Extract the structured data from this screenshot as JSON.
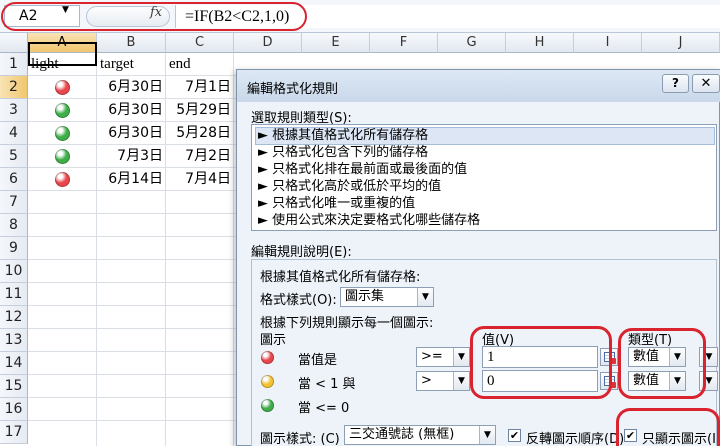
{
  "formula_bar": {
    "name_box": "A2",
    "fx": "fx",
    "formula": "=IF(B2<C2,1,0)"
  },
  "columns": [
    "A",
    "B",
    "C",
    "D",
    "E",
    "F",
    "G",
    "H",
    "I",
    "J"
  ],
  "rows": [
    "1",
    "2",
    "3",
    "4",
    "5",
    "6",
    "7",
    "8",
    "9",
    "10",
    "11",
    "12",
    "13",
    "14",
    "15",
    "16",
    "17"
  ],
  "header_row": {
    "light": "light",
    "target": "target",
    "end": "end"
  },
  "data_rows": [
    {
      "light_color": "#e8464c",
      "target": "6月30日",
      "end": "7月1日"
    },
    {
      "light_color": "#3fae49",
      "target": "6月30日",
      "end": "5月29日"
    },
    {
      "light_color": "#3fae49",
      "target": "6月30日",
      "end": "5月28日"
    },
    {
      "light_color": "#3fae49",
      "target": "7月3日",
      "end": "7月2日"
    },
    {
      "light_color": "#e8464c",
      "target": "6月14日",
      "end": "7月4日"
    }
  ],
  "dialog": {
    "title": "編輯格式化規則",
    "help_label": "?",
    "close_label": "✕",
    "select_rule_type_label": "選取規則類型(S):",
    "rule_types": [
      "► 根據其值格式化所有儲存格",
      "► 只格式化包含下列的儲存格",
      "► 只格式化排在最前面或最後面的值",
      "► 只格式化高於或低於平均的值",
      "► 只格式化唯一或重複的值",
      "► 使用公式來決定要格式化哪些儲存格"
    ],
    "edit_rule_desc_label": "編輯規則說明(E):",
    "format_all_label": "根據其值格式化所有儲存格:",
    "format_style_label": "格式樣式(O):",
    "format_style_value": "圖示集",
    "display_rule_label": "根據下列規則顯示每一個圖示:",
    "icon_header": "圖示",
    "value_header": "值(V)",
    "type_header": "類型(T)",
    "icon_rules": [
      {
        "color": "#e8464c",
        "condition": "當值是",
        "operator": ">=",
        "value": "1",
        "type": "數值"
      },
      {
        "color": "#f2c230",
        "condition": "當 < 1 與",
        "operator": ">",
        "value": "0",
        "type": "數值"
      },
      {
        "color": "#3fae49",
        "condition": "當 <= 0",
        "operator": "",
        "value": "",
        "type": ""
      }
    ],
    "icon_style_label": "圖示樣式:",
    "icon_style_shortcut": "(C)",
    "icon_style_value": "三交通號誌 (無框)",
    "reverse_order_label": "反轉圖示順序(D)",
    "reverse_order_checked": "✔",
    "show_icon_only_label": "只顯示圖示(I)",
    "show_icon_only_checked": "✔"
  }
}
